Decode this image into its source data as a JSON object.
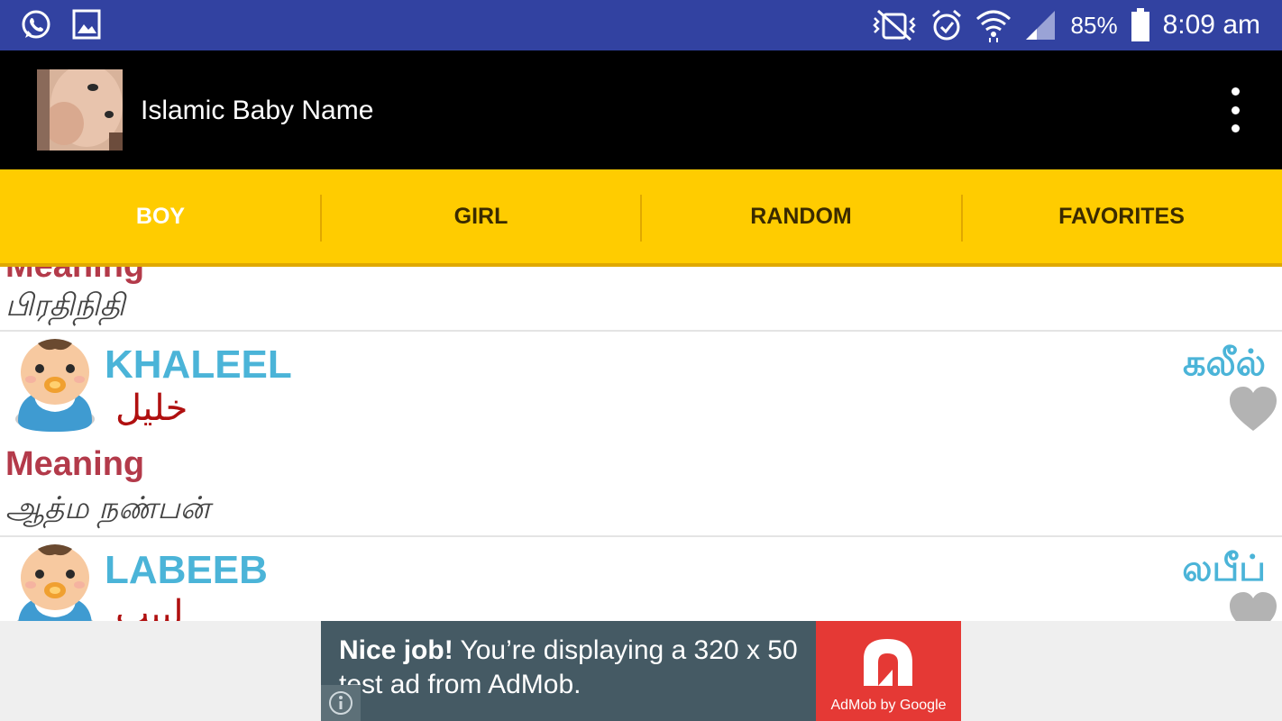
{
  "status_bar": {
    "battery_percent": "85%",
    "time": "8:09 am",
    "icons": [
      "whatsapp-icon",
      "gallery-icon",
      "vibrate-mute-icon",
      "alarm-icon",
      "wifi-icon",
      "signal-icon",
      "battery-icon"
    ]
  },
  "app_bar": {
    "title": "Islamic Baby Name",
    "menu_icon": "overflow-menu-icon"
  },
  "tabs": [
    {
      "label": "BOY",
      "active": true
    },
    {
      "label": "GIRL",
      "active": false
    },
    {
      "label": "RANDOM",
      "active": false
    },
    {
      "label": "FAVORITES",
      "active": false
    }
  ],
  "list": {
    "meaning_label": "Meaning",
    "partial_top": {
      "meaning_label": "Meaning",
      "meaning": "பிரதிநிதி"
    },
    "items": [
      {
        "name_en": "KHALEEL",
        "name_ar": "خليل",
        "name_ta": "கலீல்",
        "meaning_label": "Meaning",
        "meaning": "ஆத்ம நண்பன்",
        "favorite": false
      },
      {
        "name_en": "LABEEB",
        "name_ar": "لبيب",
        "name_ta": "லபீப்",
        "favorite": false
      }
    ]
  },
  "ad": {
    "headline": "Nice job!",
    "body": " You’re displaying a 320 x 50 test ad from AdMob.",
    "brand": "AdMob by Google",
    "colors": {
      "background": "#455a64",
      "logo": "#e53935"
    }
  },
  "colors": {
    "status_bar": "#3242a1",
    "app_bar": "#000000",
    "tab_bar": "#ffcc00",
    "name_en": "#4bb4d8",
    "name_ar": "#b01010",
    "meaning_label": "#b33a4a"
  }
}
